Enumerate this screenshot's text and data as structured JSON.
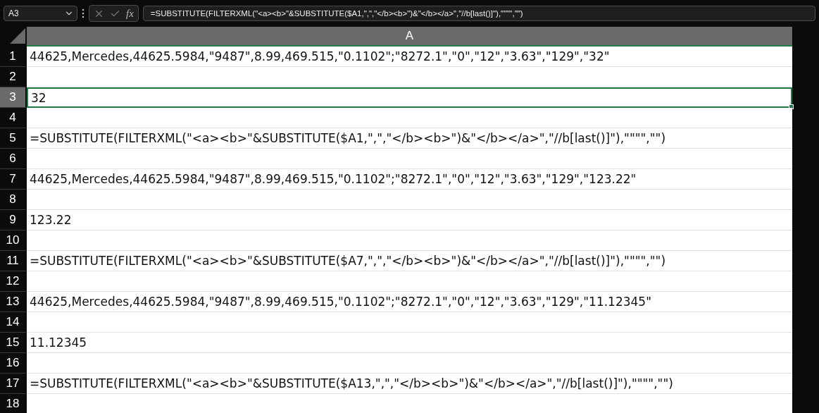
{
  "name_box": {
    "value": "A3"
  },
  "formula_bar": {
    "function_label": "fx",
    "value": "=SUBSTITUTE(FILTERXML(\"<a><b>\"&SUBSTITUTE($A1,\",\",\"</b><b>\")&\"</b></a>\",\"//b[last()]\"),\"\"\"\",\"\")"
  },
  "columns": [
    {
      "label": "A",
      "selected": true
    }
  ],
  "rows": [
    {
      "number": "1",
      "value": "44625,Mercedes,44625.5984,\"9487\",8.99,469.515,\"0.1102\";\"8272.1\",\"0\",\"12\",\"3.63\",\"129\",\"32\"",
      "selected": false
    },
    {
      "number": "2",
      "selected": false
    },
    {
      "number": "3",
      "value": "32",
      "selected": true
    },
    {
      "number": "4",
      "selected": false
    },
    {
      "number": "5",
      "value": "=SUBSTITUTE(FILTERXML(\"<a><b>\"&SUBSTITUTE($A1,\",\",\"</b><b>\")&\"</b></a>\",\"//b[last()]\"),\"\"\"\",\"\")",
      "selected": false
    },
    {
      "number": "6",
      "selected": false
    },
    {
      "number": "7",
      "value": "44625,Mercedes,44625.5984,\"9487\",8.99,469.515,\"0.1102\";\"8272.1\",\"0\",\"12\",\"3.63\",\"129\",\"123.22\"",
      "selected": false
    },
    {
      "number": "8",
      "selected": false
    },
    {
      "number": "9",
      "value": "123.22",
      "selected": false
    },
    {
      "number": "10",
      "selected": false
    },
    {
      "number": "11",
      "value": "=SUBSTITUTE(FILTERXML(\"<a><b>\"&SUBSTITUTE($A7,\",\",\"</b><b>\")&\"</b></a>\",\"//b[last()]\"),\"\"\"\",\"\")",
      "selected": false
    },
    {
      "number": "12",
      "selected": false
    },
    {
      "number": "13",
      "value": "44625,Mercedes,44625.5984,\"9487\",8.99,469.515,\"0.1102\";\"8272.1\",\"0\",\"12\",\"3.63\",\"129\",\"11.12345\"",
      "selected": false
    },
    {
      "number": "14",
      "selected": false
    },
    {
      "number": "15",
      "value": "11.12345",
      "selected": false
    },
    {
      "number": "16",
      "selected": false
    },
    {
      "number": "17",
      "value": "=SUBSTITUTE(FILTERXML(\"<a><b>\"&SUBSTITUTE($A13,\",\",\"</b><b>\")&\"</b></a>\",\"//b[last()]\"),\"\"\"\",\"\")",
      "selected": false
    },
    {
      "number": "18",
      "selected": false
    }
  ]
}
